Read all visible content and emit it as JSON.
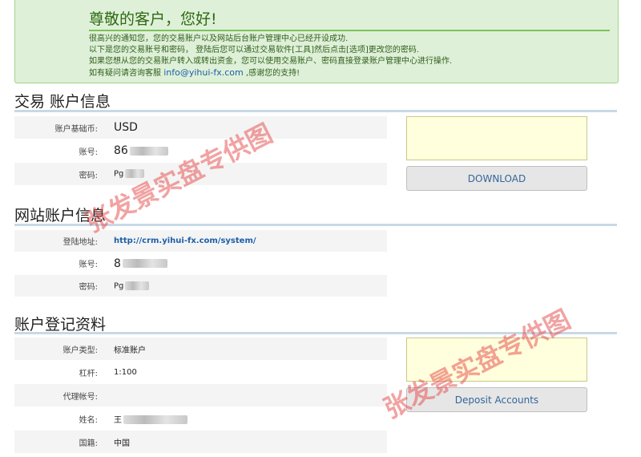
{
  "welcome": {
    "greeting": "尊敬的客户，您好!",
    "line1": "很高兴的通知您，您的交易账户以及网站后台账户管理中心已经开设成功.",
    "line2": "以下是您的交易账号和密码， 登陆后您可以通过交易软件[工具]然后点击[选项]更改您的密码.",
    "line3": "如果您想从您的交易账户转入或转出资金，您可以使用交易账户、密码直接登录账户管理中心进行操作.",
    "line4_prefix": "如有疑问请咨询客服",
    "email": "info@yihui-fx.com",
    "line4_suffix": ",感谢您的支持!"
  },
  "trading": {
    "title": "交易 账户信息",
    "rows": [
      {
        "label": "账户基础币:",
        "value": "USD"
      },
      {
        "label": "账号:",
        "value": "86"
      },
      {
        "label": "密码:",
        "value": "Pg"
      }
    ],
    "download_label": "DOWNLOAD"
  },
  "website": {
    "title": "网站账户信息",
    "rows": [
      {
        "label": "登陆地址:",
        "value": "http://crm.yihui-fx.com/system/"
      },
      {
        "label": "账号:",
        "value": "8"
      },
      {
        "label": "密码:",
        "value": "Pg"
      }
    ]
  },
  "registration": {
    "title": "账户登记资料",
    "rows": [
      {
        "label": "账户类型:",
        "value": "标准账户"
      },
      {
        "label": "杠杆:",
        "value": "1:100"
      },
      {
        "label": "代理帐号:",
        "value": ""
      },
      {
        "label": "姓名:",
        "value": "王"
      },
      {
        "label": "国籍:",
        "value": "中国"
      }
    ],
    "deposit_label": "Deposit Accounts"
  },
  "watermark_text": "张发景实盘专供图"
}
